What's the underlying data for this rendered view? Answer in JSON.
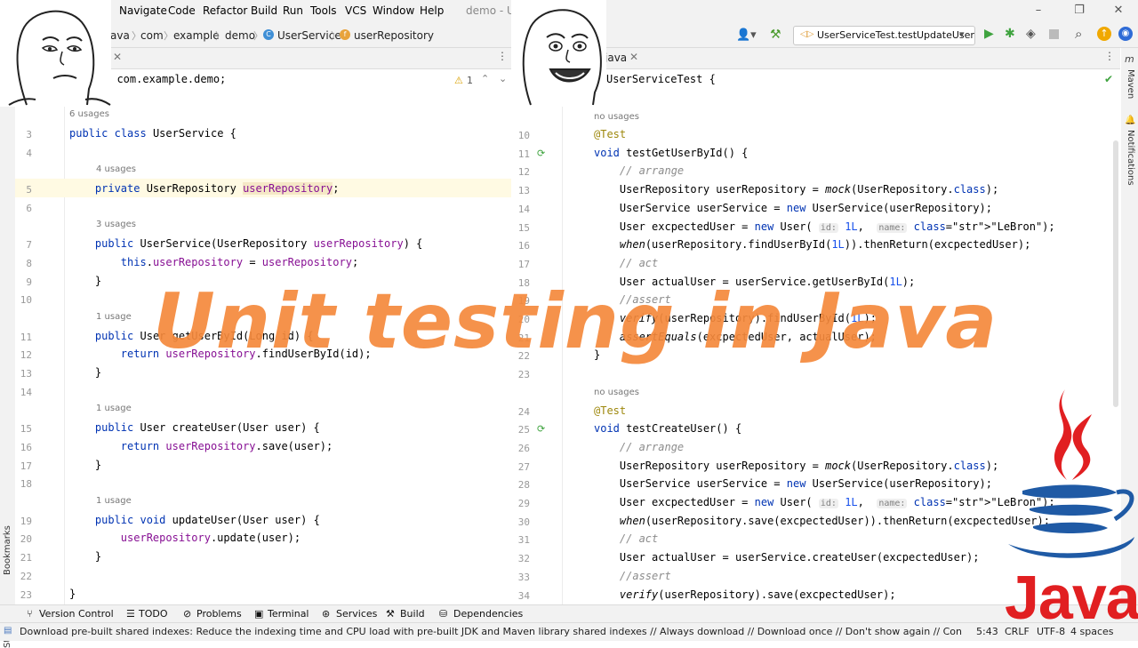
{
  "menu": {
    "items": [
      "Navigate",
      "Code",
      "Refactor",
      "Build",
      "Run",
      "Tools",
      "VCS",
      "Window",
      "Help"
    ],
    "window_title": "demo - Us"
  },
  "breadcrumb": {
    "items": [
      "ava",
      "com",
      "example",
      "demo",
      "UserService",
      "userRepository"
    ]
  },
  "run_config": {
    "label": "UserServiceTest.testUpdateUser"
  },
  "left_editor": {
    "tab_label": "",
    "inspection_count": "1",
    "header_line": "e com.example.demo;",
    "lines": [
      {
        "n": "3",
        "usage": "6 usages",
        "text": "public class UserService {"
      },
      {
        "n": "4",
        "text": ""
      },
      {
        "n": "5",
        "usage": "4 usages",
        "text": "    private UserRepository userRepository;"
      },
      {
        "n": "6",
        "text": ""
      },
      {
        "n": "7",
        "usage": "3 usages",
        "text": "    public UserService(UserRepository userRepository) {"
      },
      {
        "n": "8",
        "text": "        this.userRepository = userRepository;"
      },
      {
        "n": "9",
        "text": "    }"
      },
      {
        "n": "10",
        "text": ""
      },
      {
        "n": "11",
        "usage": "1 usage",
        "text": "    public User getUserById(Long id) {"
      },
      {
        "n": "12",
        "text": "        return userRepository.findUserById(id);"
      },
      {
        "n": "13",
        "text": "    }"
      },
      {
        "n": "14",
        "text": ""
      },
      {
        "n": "15",
        "usage": "1 usage",
        "text": "    public User createUser(User user) {"
      },
      {
        "n": "16",
        "text": "        return userRepository.save(user);"
      },
      {
        "n": "17",
        "text": "    }"
      },
      {
        "n": "18",
        "text": ""
      },
      {
        "n": "19",
        "usage": "1 usage",
        "text": "    public void updateUser(User user) {"
      },
      {
        "n": "20",
        "text": "        userRepository.update(user);"
      },
      {
        "n": "21",
        "text": "    }"
      },
      {
        "n": "22",
        "text": ""
      },
      {
        "n": "23",
        "text": "}"
      }
    ]
  },
  "right_editor": {
    "tab_label": "java",
    "header_line": "UserServiceTest {",
    "usage_1": "no usages",
    "usage_2": "no usages",
    "lines": [
      {
        "n": "10",
        "text": "@Test"
      },
      {
        "n": "11",
        "text": "void testGetUserById() {"
      },
      {
        "n": "12",
        "text": "    // arrange"
      },
      {
        "n": "13",
        "text": "    UserRepository userRepository = mock(UserRepository.class);"
      },
      {
        "n": "14",
        "text": "    UserService userService = new UserService(userRepository);"
      },
      {
        "n": "15",
        "text": "    User excpectedUser = new User( id: 1L,  name: \"LeBron\");"
      },
      {
        "n": "16",
        "text": "    when(userRepository.findUserById(1L)).thenReturn(excpectedUser);"
      },
      {
        "n": "17",
        "text": "    // act"
      },
      {
        "n": "18",
        "text": "    User actualUser = userService.getUserById(1L);"
      },
      {
        "n": "19",
        "text": "    //assert"
      },
      {
        "n": "20",
        "text": "    verify(userRepository).findUserById(1L);"
      },
      {
        "n": "21",
        "text": "    assertEquals(excpectedUser, actualUser);"
      },
      {
        "n": "22",
        "text": "}"
      },
      {
        "n": "23",
        "text": ""
      },
      {
        "n": "24",
        "text": "@Test"
      },
      {
        "n": "25",
        "text": "void testCreateUser() {"
      },
      {
        "n": "26",
        "text": "    // arrange"
      },
      {
        "n": "27",
        "text": "    UserRepository userRepository = mock(UserRepository.class);"
      },
      {
        "n": "28",
        "text": "    UserService userService = new UserService(userRepository);"
      },
      {
        "n": "29",
        "text": "    User excpectedUser = new User( id: 1L,  name: \"LeBron\");"
      },
      {
        "n": "30",
        "text": "    when(userRepository.save(excpectedUser)).thenReturn(excpectedUser);"
      },
      {
        "n": "31",
        "text": "    // act"
      },
      {
        "n": "32",
        "text": "    User actualUser = userService.createUser(excpectedUser);"
      },
      {
        "n": "33",
        "text": "    //assert"
      },
      {
        "n": "34",
        "text": "    verify(userRepository).save(excpectedUser);"
      }
    ]
  },
  "side_panels": {
    "left": [
      "Bookmarks",
      "Structure"
    ],
    "right": [
      "Maven",
      "Notifications"
    ]
  },
  "tool_windows": [
    "Version Control",
    "TODO",
    "Problems",
    "Terminal",
    "Services",
    "Build",
    "Dependencies"
  ],
  "status": {
    "message": "Download pre-built shared indexes: Reduce the indexing time and CPU load with pre-built JDK and Maven library shared indexes // Always download // Download once // Don't show again // Configure...",
    "position": "5:43",
    "line_sep": "CRLF",
    "encoding": "UTF-8",
    "indent": "4 spaces"
  },
  "overlay": {
    "title": "Unit testing in Java",
    "java_logo_text": "Java"
  },
  "colors": {
    "accent_orange": "#f5893c",
    "java_red": "#e11f21",
    "java_blue": "#1f5aa5",
    "keyword": "#0033b3",
    "field": "#871094"
  }
}
